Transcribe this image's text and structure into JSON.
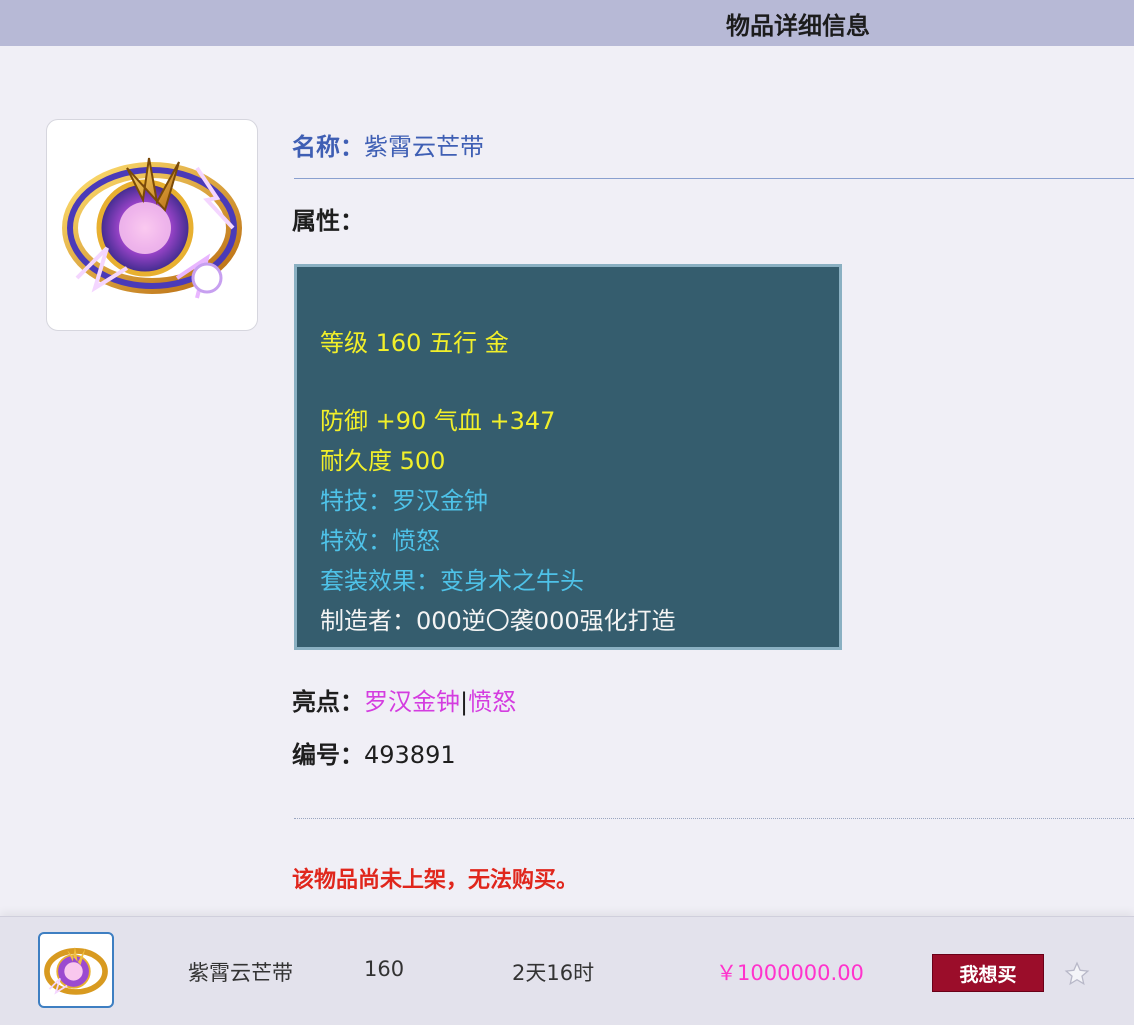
{
  "header": {
    "title": "物品详细信息"
  },
  "item": {
    "icon": "belt-item-icon",
    "name_label": "名称：",
    "name": "紫霄云芒带",
    "attributes_label": "属性：",
    "attributes": [
      {
        "text": "等级 160 五行 金",
        "color": "#f1ef2a"
      },
      {
        "text": "防御 +90 气血 +347",
        "color": "#f1ef2a"
      },
      {
        "text": "耐久度 500",
        "color": "#f1ef2a"
      },
      {
        "text": "特技：罗汉金钟",
        "color": "#4ec2e8"
      },
      {
        "text": "特效：愤怒",
        "color": "#4ec2e8"
      },
      {
        "text": "套装效果：变身术之牛头",
        "color": "#4ec2e8"
      },
      {
        "text": "制造者：000逆〇袭000强化打造",
        "color": "#f4f4f4"
      }
    ],
    "highlights_label": "亮点：",
    "highlights": [
      "罗汉金钟",
      "愤怒"
    ],
    "highlight_separator": "|",
    "id_label": "编号：",
    "id": "493891",
    "notice": "该物品尚未上架，无法购买。"
  },
  "bottom_bar": {
    "name": "紫霄云芒带",
    "level": "160",
    "time_left": "2天16时",
    "price": "￥1000000.00",
    "buy_label": "我想买",
    "favorite_icon": "star-icon"
  },
  "colors": {
    "header_bg": "#b7b9d6",
    "attr_box_bg": "#355d6e",
    "name_color": "#3f5fb4",
    "highlight_color": "#d43ce0",
    "notice_color": "#e0261c",
    "price_color": "#ff33cc",
    "buy_button_bg": "#9b0d2a"
  }
}
